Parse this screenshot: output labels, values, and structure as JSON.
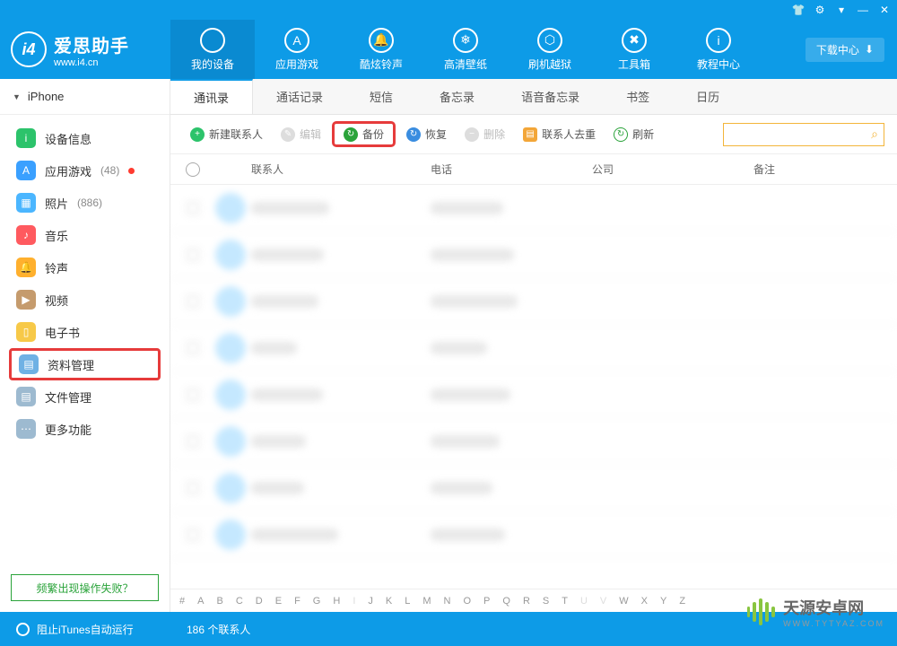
{
  "brand": {
    "name": "爱思助手",
    "site": "www.i4.cn"
  },
  "titlebar_icons": [
    "clothes-icon",
    "gear-icon",
    "menu-icon",
    "minimize-icon",
    "close-icon"
  ],
  "download_center": "下载中心",
  "nav": [
    {
      "label": "我的设备",
      "icon": ""
    },
    {
      "label": "应用游戏",
      "icon": "A"
    },
    {
      "label": "酷炫铃声",
      "icon": "🔔"
    },
    {
      "label": "高清壁纸",
      "icon": "❄"
    },
    {
      "label": "刷机越狱",
      "icon": "⬡"
    },
    {
      "label": "工具箱",
      "icon": "✖"
    },
    {
      "label": "教程中心",
      "icon": "i"
    }
  ],
  "device": "iPhone",
  "sidebar": [
    {
      "key": "info",
      "label": "设备信息",
      "color": "#2cc36b",
      "sym": "i"
    },
    {
      "key": "apps",
      "label": "应用游戏",
      "color": "#3aa0ff",
      "sym": "A",
      "count": "(48)",
      "dot": true
    },
    {
      "key": "photos",
      "label": "照片",
      "color": "#4bb6ff",
      "sym": "▦",
      "count": "(886)"
    },
    {
      "key": "music",
      "label": "音乐",
      "color": "#ff5a5f",
      "sym": "♪"
    },
    {
      "key": "ring",
      "label": "铃声",
      "color": "#ffb02e",
      "sym": "🔔"
    },
    {
      "key": "video",
      "label": "视频",
      "color": "#c59b6d",
      "sym": "▶"
    },
    {
      "key": "ebook",
      "label": "电子书",
      "color": "#f7c948",
      "sym": "▯"
    },
    {
      "key": "data",
      "label": "资料管理",
      "color": "#6fb1e4",
      "sym": "▤",
      "highlighted": true
    },
    {
      "key": "files",
      "label": "文件管理",
      "color": "#9dbad0",
      "sym": "▤"
    },
    {
      "key": "more",
      "label": "更多功能",
      "color": "#9dbad0",
      "sym": "⋯"
    }
  ],
  "fail_button": "频繁出现操作失败？",
  "tabs": [
    "通讯录",
    "通话记录",
    "短信",
    "备忘录",
    "语音备忘录",
    "书签",
    "日历"
  ],
  "toolbar": {
    "new": {
      "label": "新建联系人",
      "color": "#2cc36b",
      "sym": "+"
    },
    "edit": {
      "label": "编辑",
      "color": "#bbb",
      "sym": "✎",
      "disabled": true
    },
    "backup": {
      "label": "备份",
      "color": "#2aa33a",
      "sym": "↻",
      "boxed": true
    },
    "restore": {
      "label": "恢复",
      "color": "#3a8de0",
      "sym": "↻"
    },
    "delete": {
      "label": "删除",
      "color": "#bbb",
      "sym": "−",
      "disabled": true
    },
    "dedupe": {
      "label": "联系人去重",
      "color": "#f3a638",
      "sym": "▤"
    },
    "refresh": {
      "label": "刷新",
      "color": "#2aa33a",
      "sym": "↻"
    }
  },
  "columns": {
    "contact": "联系人",
    "phone": "电话",
    "company": "公司",
    "remark": "备注"
  },
  "alpha": [
    "#",
    "A",
    "B",
    "C",
    "D",
    "E",
    "F",
    "G",
    "H",
    "I",
    "J",
    "K",
    "L",
    "M",
    "N",
    "O",
    "P",
    "Q",
    "R",
    "S",
    "T",
    "U",
    "V",
    "W",
    "X",
    "Y",
    "Z"
  ],
  "alpha_muted": [
    "I",
    "U",
    "V"
  ],
  "status": {
    "itunes": "阻止iTunes自动运行",
    "count": "186 个联系人"
  },
  "watermark": {
    "name": "天源安卓网",
    "sub": "WWW.TYTYAZ.COM"
  }
}
